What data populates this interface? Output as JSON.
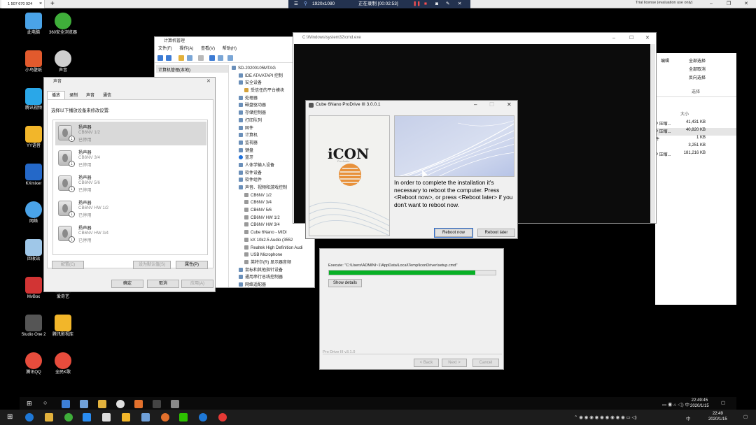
{
  "browser": {
    "tab_title": "1 507 670 924",
    "tab_close": "×",
    "new_tab": "+",
    "trial": "Trial license (evaluation use only)",
    "min": "–",
    "restore": "❐",
    "close": "✕"
  },
  "recorder": {
    "resolution": "1920x1080",
    "status": "正在录制 [00:02:53]"
  },
  "desktop_icons": [
    {
      "label": "此电脑",
      "color": "#4aa3e8"
    },
    {
      "label": "360安全浏览器",
      "color": "#3fae3a"
    },
    {
      "label": "小鸟壁纸",
      "color": "#e25a2d"
    },
    {
      "label": "声音",
      "color": "#cfcfcf"
    },
    {
      "label": "腾讯视频",
      "color": "#2aa7e8"
    },
    {
      "label": "YY语音",
      "color": "#f2b62a"
    },
    {
      "label": "KXmixer",
      "color": "#2468c8"
    },
    {
      "label": "网络",
      "color": "#4aa3e8"
    },
    {
      "label": "回收站",
      "color": "#9fc7e8"
    },
    {
      "label": "MvBox",
      "color": "#d23434"
    },
    {
      "label": "爱奇艺",
      "color": "#111111"
    },
    {
      "label": "Studio One 2",
      "color": "#555555"
    },
    {
      "label": "腾讯影视库",
      "color": "#f2b62a"
    },
    {
      "label": "腾讯QQ",
      "color": "#e74c3c"
    },
    {
      "label": "全民K歌",
      "color": "#e74c3c"
    }
  ],
  "device_manager": {
    "title": "计算机管理",
    "menu": [
      "文件(F)",
      "操作(A)",
      "查看(V)",
      "帮助(H)"
    ],
    "left_root": "计算机管理(本地)",
    "tree": [
      "SD-20200105MTAG",
      "IDE ATA/ATAPI 控制",
      "安全设备",
      "受信任的平台模块",
      "处理器",
      "磁盘驱动器",
      "存储控制器",
      "打印队列",
      "固件",
      "计算机",
      "监视器",
      "键盘",
      "蓝牙",
      "人体学输入设备",
      "软件设备",
      "软件组件",
      "声音、视频和游戏控制",
      "CB6NV 1/2",
      "CB6NV 3/4",
      "CB6NV 5/6",
      "CB6NV HW 1/2",
      "CB6NV HW 3/4",
      "Cube 6Nano - MIDI",
      "kX 10k2.5 Audio (3552",
      "Realtek High Definition Audi",
      "USB Microphone",
      "英特尔(R) 显示器音频",
      "鼠标和其他指针设备",
      "通用串行总线控制器",
      "网络适配器"
    ]
  },
  "explorer": {
    "ribbon": [
      "全部选择",
      "全部取消",
      "反向选择"
    ],
    "ribbon_left": "编辑",
    "group": "选择",
    "col_size": "大小",
    "rows": [
      {
        "type": "P 压缩...",
        "size": "41,431 KB"
      },
      {
        "type": "P 压缩...",
        "size": "40,820 KB"
      },
      {
        "type": "件",
        "size": "1 KB"
      },
      {
        "type": "",
        "size": "3,251 KB"
      },
      {
        "type": "P 压缩...",
        "size": "181,216 KB"
      }
    ]
  },
  "cmd": {
    "title": "C:\\Windows\\system32\\cmd.exe"
  },
  "sound": {
    "title": "声音",
    "tabs": [
      "播放",
      "录制",
      "声音",
      "通信"
    ],
    "hint": "选择以下播放设备来修改设置:",
    "devices": [
      {
        "name": "扬声器",
        "sub": "CB6NV 1/2",
        "state": "已停用"
      },
      {
        "name": "扬声器",
        "sub": "CB6NV 3/4",
        "state": "已停用"
      },
      {
        "name": "扬声器",
        "sub": "CB6NV 5/6",
        "state": "已停用"
      },
      {
        "name": "扬声器",
        "sub": "CB6NV HW 1/2",
        "state": "已停用"
      },
      {
        "name": "扬声器",
        "sub": "CB6NV HW 3/4",
        "state": "已停用"
      }
    ],
    "configure": "配置(C)",
    "set_default": "设为默认值(S)",
    "properties": "属性(P)",
    "ok": "确定",
    "cancel": "取消",
    "apply": "应用(A)"
  },
  "installer": {
    "execute": "Execute: \"C:\\Users\\ADMINI~1\\AppData\\Local\\Temp\\IconDriver\\setup.cmd\"",
    "progress": 0.88,
    "show_details": "Show details",
    "brand": "Pro Drive III v3.1.0",
    "back": "< Back",
    "next": "Next >",
    "cancel": "Cancel"
  },
  "reboot_dialog": {
    "title": "Cube 6Nano ProDrive III 3.0.0.1",
    "logo": "iCON",
    "logo_sub": "Pro Audio",
    "message": "In order to complete the installation it's necessary to reboot the computer. Press <Reboot now>, or press <Reboot later> if you don't want to reboot now.",
    "reboot_now": "Reboot now",
    "reboot_later": "Reboot later"
  },
  "taskbar": {
    "clock1_time": "22:49:45",
    "clock1_date": "2020/1/15",
    "clock2_time": "22:49",
    "clock2_date": "2020/1/15",
    "ime": "中"
  }
}
